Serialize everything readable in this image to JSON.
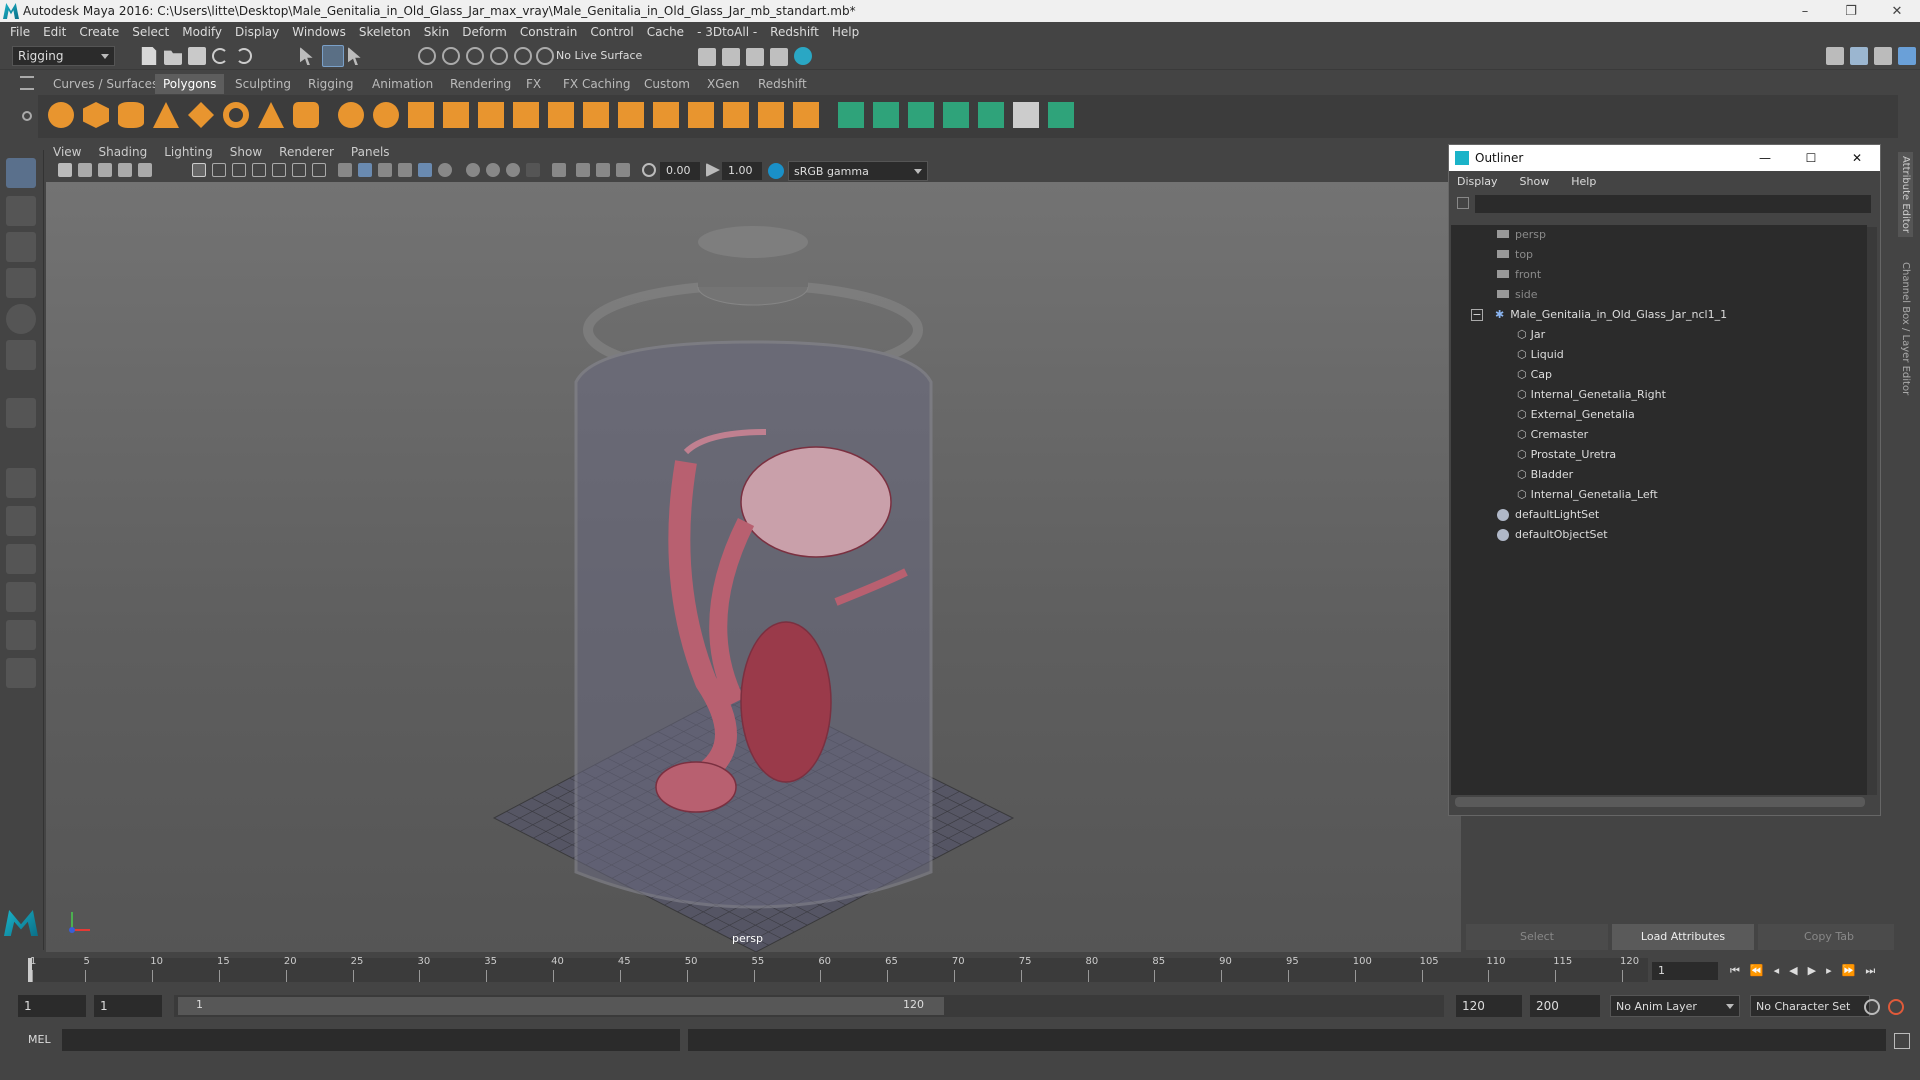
{
  "app": {
    "title": "Autodesk Maya 2016: C:\\Users\\litte\\Desktop\\Male_Genitalia_in_Old_Glass_Jar_max_vray\\Male_Genitalia_in_Old_Glass_Jar_mb_standart.mb*",
    "minimize": "–",
    "restore": "❐",
    "close": "✕"
  },
  "menubar": [
    "File",
    "Edit",
    "Create",
    "Select",
    "Modify",
    "Display",
    "Windows",
    "Skeleton",
    "Skin",
    "Deform",
    "Constrain",
    "Control",
    "Cache",
    "- 3DtoAll -",
    "Redshift",
    "Help"
  ],
  "statusline": {
    "menu_set": "Rigging",
    "live_surface": "No Live Surface"
  },
  "shelf": {
    "tabs": [
      "Curves / Surfaces",
      "Polygons",
      "Sculpting",
      "Rigging",
      "Animation",
      "Rendering",
      "FX",
      "FX Caching",
      "Custom",
      "XGen",
      "Redshift"
    ],
    "active_tab": "Polygons"
  },
  "viewport": {
    "menu": [
      "View",
      "Shading",
      "Lighting",
      "Show",
      "Renderer",
      "Panels"
    ],
    "exposure": "0.00",
    "gamma": "1.00",
    "colorspace": "sRGB gamma",
    "camera_label": "persp"
  },
  "outliner": {
    "title": "Outliner",
    "menu": [
      "Display",
      "Show",
      "Help"
    ],
    "cameras": [
      "persp",
      "top",
      "front",
      "side"
    ],
    "group": {
      "expand": "−",
      "name": "Male_Genitalia_in_Old_Glass_Jar_ncl1_1"
    },
    "children": [
      "Jar",
      "Liquid",
      "Cap",
      "Internal_Genetalia_Right",
      "External_Genetalia",
      "Cremaster",
      "Prostate_Uretra",
      "Bladder",
      "Internal_Genetalia_Left"
    ],
    "sets": [
      "defaultLightSet",
      "defaultObjectSet"
    ]
  },
  "right_panel": {
    "buttons": [
      "Select",
      "Load Attributes",
      "Copy Tab"
    ],
    "vertical_tabs": [
      "Attribute Editor",
      "Channel Box / Layer Editor"
    ]
  },
  "timeline": {
    "ticks": [
      "1",
      "5",
      "10",
      "15",
      "20",
      "25",
      "30",
      "35",
      "40",
      "45",
      "50",
      "55",
      "60",
      "65",
      "70",
      "75",
      "80",
      "85",
      "90",
      "95",
      "100",
      "105",
      "110",
      "115",
      "120"
    ],
    "current_frame": "1"
  },
  "range": {
    "start": "1",
    "anim_start": "1",
    "slider_start": "1",
    "slider_end": "120",
    "end": "120",
    "anim_end": "200",
    "anim_layer": "No Anim Layer",
    "character_set": "No Character Set"
  },
  "cmdline": {
    "label": "MEL"
  },
  "colors": {
    "ui_bg": "#444444",
    "field_bg": "#2b2b2b",
    "shelf_orange": "#e8952f",
    "shelf_green": "#2fa37a",
    "tool_blue": "#5fa8e8",
    "accent": "#1ab3c8"
  }
}
